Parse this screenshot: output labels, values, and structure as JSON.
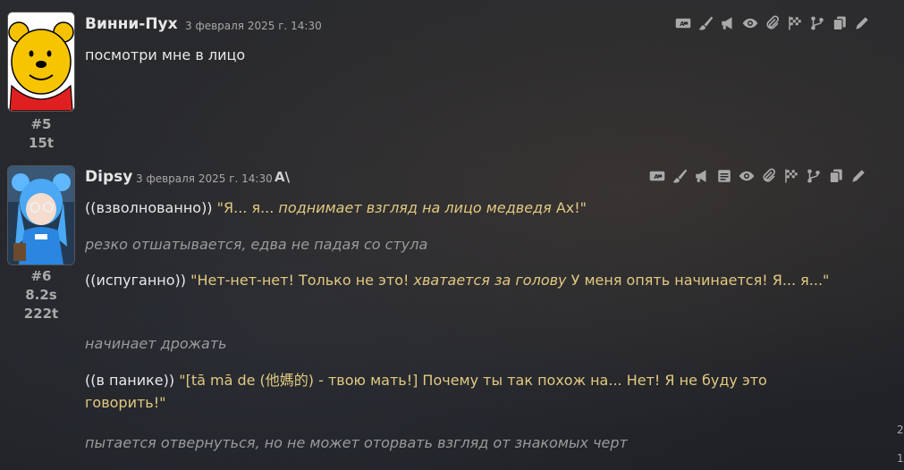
{
  "messages": [
    {
      "author": "Винни-Пух",
      "timestamp": "3 февраля 2025 г. 14:30",
      "number": "#5",
      "tokens": "15t",
      "text": "посмотри мне в лицо",
      "avatar": "winnie-the-pooh-avatar"
    },
    {
      "author": "Dipsy",
      "timestamp": "3 февраля 2025 г. 14:30",
      "badge": "A\\",
      "number": "#6",
      "time_gen": "8.2s",
      "tokens": "222t",
      "avatar": "anime-girl-avatar",
      "lines": {
        "p1_ooc": "((взволнованно))",
        "p1_q1": " \"Я... я... ",
        "p1_it": "поднимает взгляд на лицо медведя",
        "p1_q2": " Ах!\"",
        "p2": "резко отшатывается, едва не падая со стула",
        "p3_ooc": "((испуганно))",
        "p3_q1": " \"Нет-нет-нет! Только не это! ",
        "p3_it": "хватается за голову",
        "p3_q2": " У меня опять начинается! Я... я...\"",
        "p4": "начинает дрожать",
        "p5_ooc": "((в панике))",
        "p5_q": " \"[tā mā de (他媽的) - твою мать!] Почему ты так похож на... Нет! Я не буду это говорить!\"",
        "p6": "пытается отвернуться, но не может оторвать взгляд от знакомых черт"
      }
    }
  ],
  "toolbar_icons_1": [
    "translate-icon",
    "brush-icon",
    "megaphone-icon",
    "eye-icon",
    "paperclip-icon",
    "flag-icon",
    "branch-icon",
    "copy-icon",
    "pencil-icon"
  ],
  "toolbar_icons_2": [
    "translate-icon",
    "brush-icon",
    "megaphone-icon",
    "note-icon",
    "eye-icon",
    "paperclip-icon",
    "flag-icon",
    "branch-icon",
    "copy-icon",
    "pencil-icon"
  ],
  "edge_text": [
    "2",
    "1"
  ]
}
